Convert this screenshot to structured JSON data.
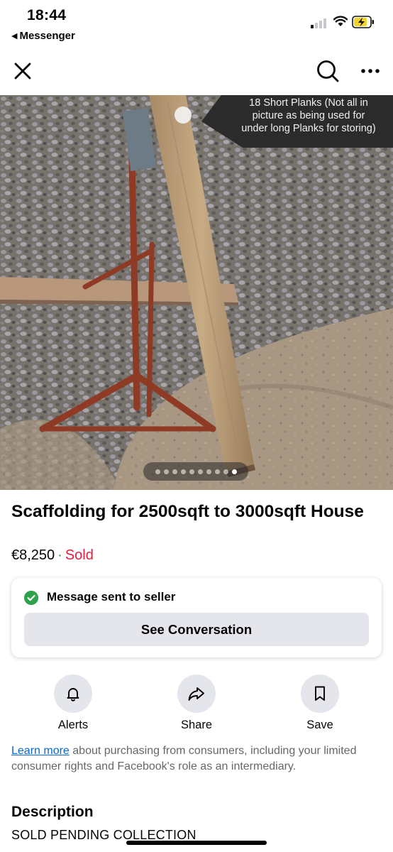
{
  "status_bar": {
    "time": "18:44",
    "back_app": "Messenger"
  },
  "nav": {
    "close_icon": "close-icon",
    "search_icon": "search-icon",
    "more_icon": "more-icon"
  },
  "photo": {
    "caption": [
      "18 Short Planks (Not all in",
      "picture as being used for",
      "under long Planks for storing)"
    ],
    "total_photos": 10,
    "active_photo": 10
  },
  "listing": {
    "title": "Scaffolding for 2500sqft to 3000sqft House",
    "price": "€8,250",
    "separator": "·",
    "status": "Sold",
    "status_color": "#e41e3f"
  },
  "message_card": {
    "status_text": "Message sent to seller",
    "button_label": "See Conversation",
    "check_color": "#31a24c"
  },
  "actions": [
    {
      "label": "Alerts",
      "icon": "bell-icon"
    },
    {
      "label": "Share",
      "icon": "share-icon"
    },
    {
      "label": "Save",
      "icon": "bookmark-icon"
    }
  ],
  "disclaimer": {
    "link_text": "Learn more",
    "text": " about purchasing from consumers, including your limited consumer rights and Facebook's role as an intermediary."
  },
  "description": {
    "heading": "Description",
    "body": "SOLD PENDING COLLECTION"
  },
  "colors": {
    "link": "#0a66d8",
    "button_bg": "#e4e6eb",
    "secondary_text": "#65676b"
  }
}
